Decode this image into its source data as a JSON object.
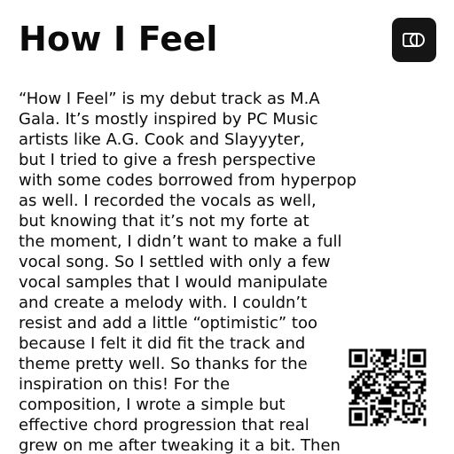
{
  "track": {
    "title": "How I Feel"
  },
  "share_button": {
    "icon": "link-icon"
  },
  "description": {
    "lines": [
      "“How I Feel” is my debut track as M.A",
      "Gala. It’s mostly inspired by PC Music",
      "artists like A.G. Cook and Slayyyter,",
      "but I tried to give a fresh perspective",
      "with some codes borrowed from hyperpop",
      "as well. I recorded the vocals as well,",
      "but knowing that it’s not my forte at",
      "the moment, I didn’t want to make a full",
      "vocal song. So I settled with only a few",
      "vocal samples that I would manipulate",
      "and create a melody with. I couldn’t",
      "resist and add a little “optimistic” too",
      "because I felt it did fit the track and",
      "theme pretty well. So thanks for the",
      "inspiration on this! For the",
      "composition, I wrote a simple but",
      "effective chord progression that real",
      "grew on me after tweaking it a bit. Then"
    ]
  },
  "qr_code": {
    "icon": "qr-code-icon"
  },
  "colors": {
    "text": "#0b0b0b",
    "button_bg": "#151515",
    "button_icon": "#ffffff",
    "background": "#ffffff"
  }
}
